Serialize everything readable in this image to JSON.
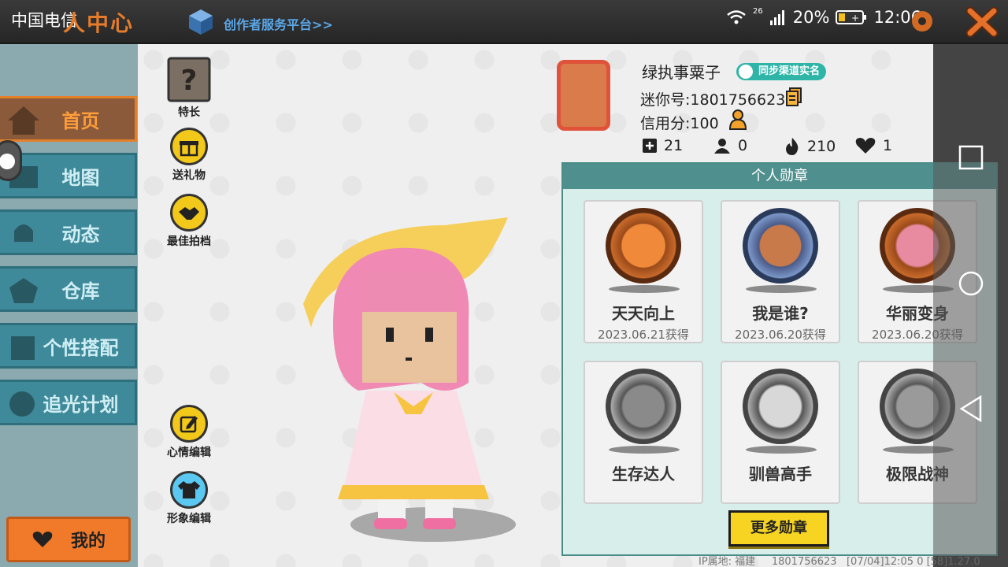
{
  "status_bar": {
    "carrier": "中国电信",
    "signal_label": "26",
    "battery": "20%",
    "time": "12:06"
  },
  "header": {
    "title": "人中心",
    "creator_link": "创作者服务平台>>"
  },
  "sidebar": {
    "items": [
      {
        "label": "首页",
        "active": true
      },
      {
        "label": "地图",
        "active": false
      },
      {
        "label": "动态",
        "active": false
      },
      {
        "label": "仓库",
        "active": false
      },
      {
        "label": "个性搭配",
        "active": false
      },
      {
        "label": "追光计划",
        "active": false
      }
    ],
    "mine_label": "我的"
  },
  "tools": {
    "specialty": "特长",
    "send_gift": "送礼物",
    "best_partner": "最佳拍档",
    "mood_edit": "心情编辑",
    "image_edit": "形象编辑"
  },
  "profile": {
    "name": "绿执事粟子",
    "real_name_badge": "同步渠道实名",
    "mini_id": "迷你号:1801756623",
    "credit": "信用分:100",
    "stats": {
      "follow": "21",
      "fans": "0",
      "heat": "210",
      "likes": "1"
    }
  },
  "medals": {
    "header": "个人勋章",
    "items": [
      {
        "name": "天天向上",
        "date": "2023.06.21获得",
        "color": "#d97a3a"
      },
      {
        "name": "我是谁?",
        "date": "2023.06.20获得",
        "color": "#5a7aa8"
      },
      {
        "name": "华丽变身",
        "date": "2023.06.20获得",
        "color": "#d97a3a"
      },
      {
        "name": "生存达人",
        "date": "",
        "color": "#9a9a9a"
      },
      {
        "name": "驯兽高手",
        "date": "",
        "color": "#9a9a9a"
      },
      {
        "name": "极限战神",
        "date": "",
        "color": "#9a9a9a"
      }
    ],
    "more_label": "更多勋章"
  },
  "footer": {
    "ip": "IP属地: 福建",
    "uid": "1801756623",
    "build": "[07/04]12:05 0  [58]1.27.0"
  },
  "colors": {
    "accent_orange": "#f07a2a",
    "nav_teal": "#3f8a9a",
    "medal_panel": "#4f8f8d"
  }
}
